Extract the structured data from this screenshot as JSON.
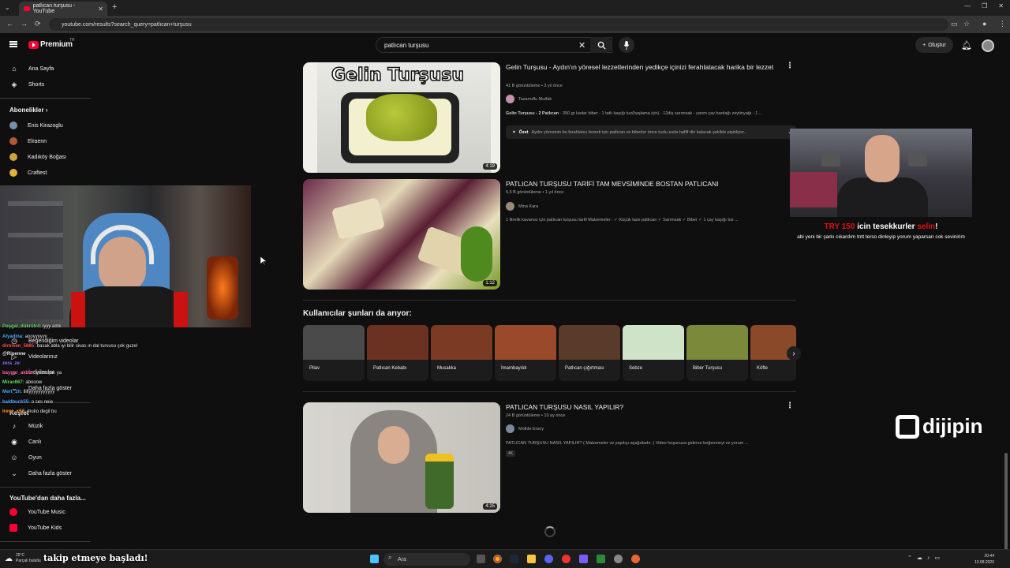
{
  "browser": {
    "tab_title": "patlıcan turşusu - YouTube",
    "new_tab": "+",
    "url": "youtube.com/results?search_query=patlıcan+turşusu"
  },
  "header": {
    "logo": "Premium",
    "logo_region": "TR",
    "search_query": "patlıcan turşusu",
    "create_label": "Oluştur"
  },
  "sidebar": {
    "home": "Ana Sayfa",
    "shorts": "Shorts",
    "subscriptions_head": "Abonelikler",
    "subs": [
      {
        "name": "Enis Kirazoglu",
        "color": "#7a8ea8"
      },
      {
        "name": "Elraenn",
        "color": "#b05a3a"
      },
      {
        "name": "Kadıköy Boğası",
        "color": "#c9a63b"
      },
      {
        "name": "Craftest",
        "color": "#e0b23a"
      }
    ],
    "liked": "Beğendiğim videolar",
    "your_videos": "Videolarınız",
    "downloads": "İndirilenler",
    "more": "Daha fazla göster",
    "explore_head": "Keşfet",
    "music": "Müzik",
    "live": "Canlı",
    "gaming": "Oyun",
    "more2": "Daha fazla göster",
    "yt_more_head": "YouTube'dan daha fazla...",
    "yt_music": "YouTube Music",
    "yt_kids": "YouTube Kids"
  },
  "chat": [
    {
      "user": "Poşgal_dükrütr4:",
      "msg": "iyyy amk"
    },
    {
      "user": "Alyadina:",
      "msg": "aooyyyyyy"
    },
    {
      "user": "dirnisen_5885:",
      "msg": "basak abla iyi bilir sivas ın dal tursusu çok guzel"
    },
    {
      "user": "@Ripenne",
      "msg": ""
    },
    {
      "user": "zera_ze:",
      "msg": ""
    },
    {
      "user": "baygar_akbur:",
      "msg": "yumuşak ya"
    },
    {
      "user": "Mirac667:",
      "msg": "abooow"
    },
    {
      "user": "Mert_1h:",
      "msg": "lllllyyyyyyyyyyy"
    },
    {
      "user": "baldbuck55:",
      "msg": "o ses neie"
    },
    {
      "user": "Irene_x52:",
      "msg": "muko degil bu"
    }
  ],
  "results": [
    {
      "title": "Gelin Turşusu - Aydın'ın yöresel lezzetlerinden yedikçe içinizi ferahlatacak harika bir lezzet",
      "meta": "41 B görüntüleme • 3 yıl önce",
      "channel": "Tasarruflu Mutfak",
      "desc_bold": "Gelin Turşusu - 2 Patlıcan",
      "desc": " - 350 gr kadar biber - 1 tatlı kaşığı tuz(haşlama için) - 12diş sarımsak - yarım çay bardağı zeytinyağı - 1 ...",
      "duration": "4:19",
      "thumb_text": "Gelin Turşusu"
    },
    {
      "title": "PATLICAN TURŞUSU TARİFİ TAM MEVSİMİNDE BOSTAN PATLICANI",
      "meta": "5,5 B görüntüleme • 1 yıl önce",
      "channel": "Mina Kara",
      "desc": "1 litrelik kavanoz için patlıcan turşusu tarifi Malzemeler : ✓ Küçük taze patlıcan ✓ Sarımsak ✓ Biber ✓ 1 çay kaşığı toz ...",
      "duration": "1:12"
    },
    {
      "title": "PATLICAN TURŞUSU NASIL YAPILIR?",
      "meta": "24 B görüntüleme • 10 ay önce",
      "channel": "Müfide Ersoy",
      "desc": "PATLICAN TURŞUSU NASIL YAPILIR? ( Malzemeler ve yapılışı aşağıdadır. ) Video hoşunuza giderse beğenmeyi ve yorum ...",
      "duration": "4:25",
      "badge": "4K"
    }
  ],
  "summary": {
    "label": "Özet",
    "text": "Aydın yöresinin bu ferahlatıcı lezzeti için patlıcan ve biberler önce tuzlu suda haflif diri kalacak şekilde pişiriliyor..."
  },
  "related": {
    "title": "Kullanıcılar şunları da arıyor:",
    "items": [
      {
        "label": "Pilav",
        "color": "#4a4a4a"
      },
      {
        "label": "Patlıcan Kebabı",
        "color": "#6b3222"
      },
      {
        "label": "Musakka",
        "color": "#7a3a24"
      },
      {
        "label": "İmambayıldı",
        "color": "#9a4a2a"
      },
      {
        "label": "Patlıcan çığırtması",
        "color": "#5a3a2a"
      },
      {
        "label": "Sebze",
        "color": "#cfe3c9"
      },
      {
        "label": "Biber Turşusu",
        "color": "#7a8a3a"
      },
      {
        "label": "Köfte",
        "color": "#8a4a2a"
      }
    ]
  },
  "overlay": {
    "thanks_pre": "TRY 150",
    "thanks_mid": " icin tesekkurler ",
    "thanks_post": "selin",
    "thanks_end": "!",
    "thanks_msg": "abi yeni bir şarkı cıkardım tntt terso dinleyip yorum yaparsan cok sevinirim",
    "brand": "dijipin",
    "follow": "takip etmeye başladı!"
  },
  "taskbar": {
    "weather_temp": "25°C",
    "weather_desc": "Parçalı bulutlu",
    "search": "Ara",
    "time": "20:44",
    "date": "13.08.2026"
  }
}
